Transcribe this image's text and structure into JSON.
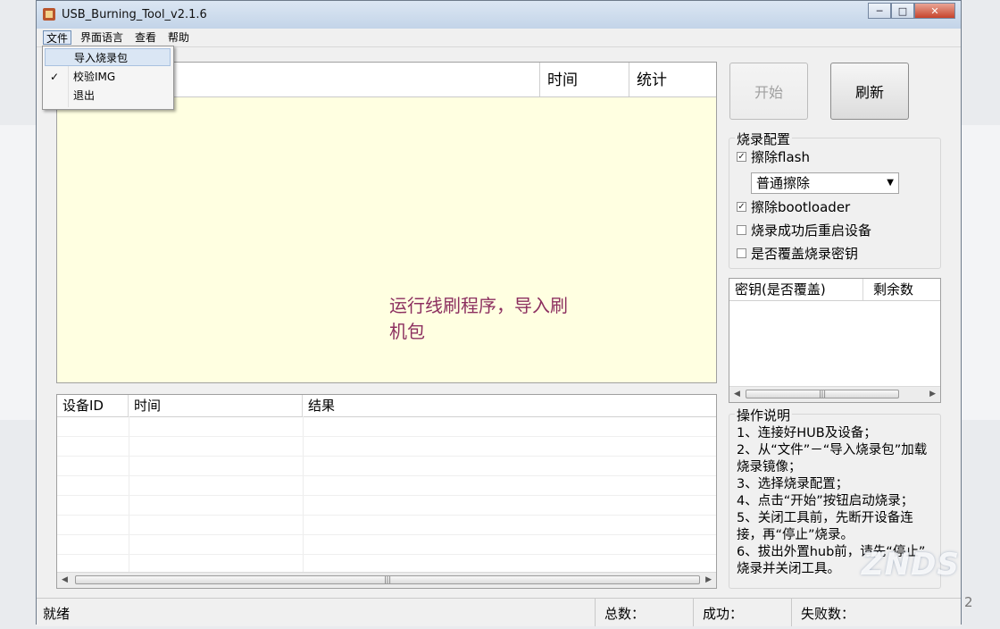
{
  "window": {
    "title": "USB_Burning_Tool_v2.1.6"
  },
  "menubar": {
    "items": [
      "文件",
      "界面语言",
      "查看",
      "帮助"
    ]
  },
  "file_menu": {
    "items": [
      {
        "label": "导入烧录包",
        "checked": false,
        "highlighted": true
      },
      {
        "label": "校验IMG",
        "checked": true,
        "highlighted": false
      },
      {
        "label": "退出",
        "checked": false,
        "highlighted": false
      }
    ]
  },
  "log_panel": {
    "columns": [
      "时间",
      "统计"
    ],
    "message_line1": "运行线刷程序，导入刷",
    "message_line2": "机包"
  },
  "results_table": {
    "columns": [
      "设备ID",
      "时间",
      "结果"
    ]
  },
  "buttons": {
    "start": "开始",
    "refresh": "刷新"
  },
  "burn_config": {
    "title": "烧录配置",
    "erase_flash": {
      "label": "擦除flash",
      "checked": true
    },
    "erase_mode": "普通擦除",
    "erase_bootloader": {
      "label": "擦除bootloader",
      "checked": true
    },
    "reboot_after": {
      "label": "烧录成功后重启设备",
      "checked": false
    },
    "overwrite_key": {
      "label": "是否覆盖烧录密钥",
      "checked": false
    }
  },
  "key_table": {
    "columns": [
      "密钥(是否覆盖)",
      "剩余数"
    ]
  },
  "instructions": {
    "title": "操作说明",
    "lines": [
      "1、连接好HUB及设备；",
      "2、从“文件”－“导入烧录包”加载",
      "烧录镜像；",
      "3、选择烧录配置；",
      "4、点击“开始”按钮启动烧录；",
      "5、关闭工具前，先断开设备连",
      "接，再“停止”烧录。",
      "6、拔出外置hub前，请先“停止”",
      "烧录并关闭工具。"
    ]
  },
  "statusbar": {
    "status": "就绪",
    "total_label": "总数：",
    "success_label": "成功：",
    "fail_label": "失败数："
  },
  "watermark": "ZNDS",
  "page_number": "2",
  "icons": [
    "app-icon",
    "minimize-icon",
    "maximize-icon",
    "close-icon",
    "checkmark-icon",
    "dropdown-arrow-icon",
    "scroll-left-arrow-icon",
    "scroll-right-arrow-icon"
  ]
}
